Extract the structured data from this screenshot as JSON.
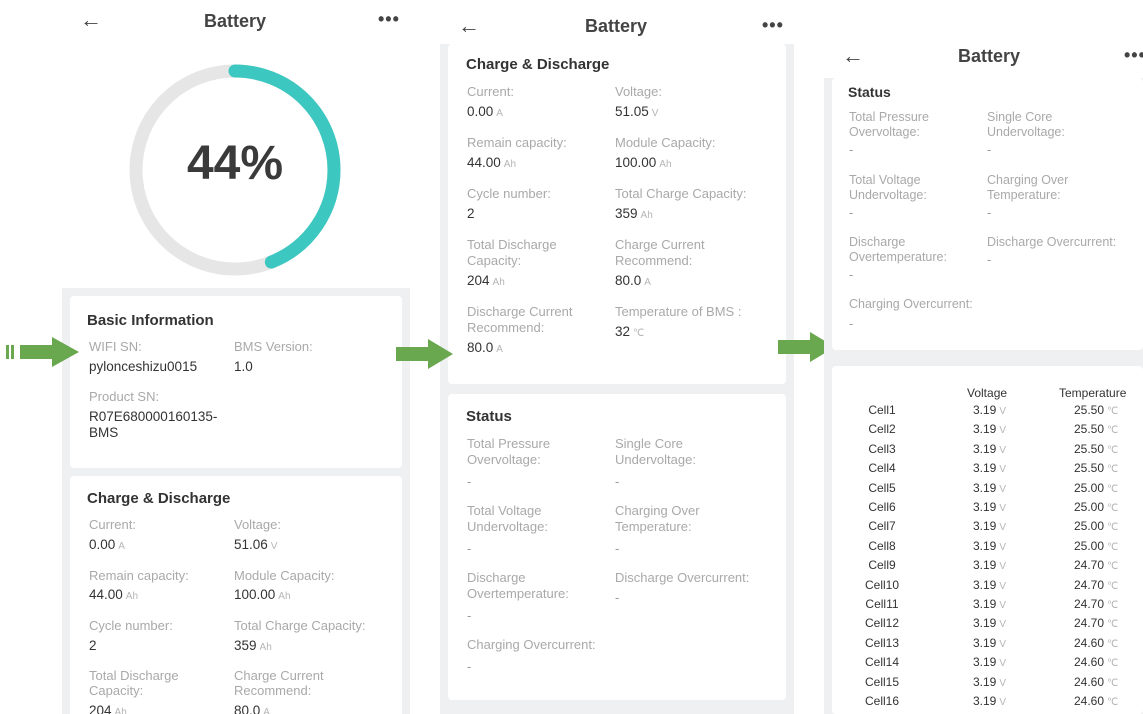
{
  "screens": [
    {
      "title": "Battery",
      "back_icon": "arrow-left-icon",
      "more_icon": "more-icon"
    },
    {
      "title": "Battery",
      "back_icon": "arrow-left-icon",
      "more_icon": "more-icon"
    },
    {
      "title": "Battery",
      "back_icon": "arrow-left-icon",
      "more_icon": "more-icon"
    }
  ],
  "gauge": {
    "percent_label": "44%",
    "value": 0.44,
    "track_color": "#e6e6e6",
    "fill_color": "#3cc8c0"
  },
  "basic_info": {
    "title": "Basic Information",
    "wifi_sn_label": "WIFI SN:",
    "wifi_sn_value": "pylonceshizu0015",
    "bms_version_label": "BMS Version:",
    "bms_version_value": "1.0",
    "product_sn_label": "Product SN:",
    "product_sn_value_line1": "R07E680000160135-",
    "product_sn_value_line2": "BMS"
  },
  "charge1": {
    "title": "Charge & Discharge",
    "current_label": "Current:",
    "current_value": "0.00",
    "current_unit": "A",
    "voltage_label": "Voltage:",
    "voltage_value": "51.06",
    "voltage_unit": "V",
    "remain_label": "Remain capacity:",
    "remain_value": "44.00",
    "remain_unit": "Ah",
    "module_label": "Module Capacity:",
    "module_value": "100.00",
    "module_unit": "Ah",
    "cycle_label": "Cycle number:",
    "cycle_value": "2",
    "total_charge_label": "Total Charge Capacity:",
    "total_charge_value": "359",
    "total_charge_unit": "Ah",
    "total_discharge_label1": "Total Discharge",
    "total_discharge_label2": "Capacity:",
    "total_discharge_value": "204",
    "total_discharge_unit": "Ah",
    "charge_rec_label1": "Charge Current",
    "charge_rec_label2": "Recommend:",
    "charge_rec_value": "80.0",
    "charge_rec_unit": "A"
  },
  "charge2": {
    "title": "Charge & Discharge",
    "current_label": "Current:",
    "current_value": "0.00",
    "current_unit": "A",
    "voltage_label": "Voltage:",
    "voltage_value": "51.05",
    "voltage_unit": "V",
    "remain_label": "Remain capacity:",
    "remain_value": "44.00",
    "remain_unit": "Ah",
    "module_label": "Module Capacity:",
    "module_value": "100.00",
    "module_unit": "Ah",
    "cycle_label": "Cycle number:",
    "cycle_value": "2",
    "total_charge_label": "Total Charge Capacity:",
    "total_charge_value": "359",
    "total_charge_unit": "Ah",
    "total_discharge_label1": "Total Discharge",
    "total_discharge_label2": "Capacity:",
    "total_discharge_value": "204",
    "total_discharge_unit": "Ah",
    "charge_rec_label1": "Charge Current",
    "charge_rec_label2": "Recommend:",
    "charge_rec_value": "80.0",
    "charge_rec_unit": "A",
    "discharge_rec_label1": "Discharge Current",
    "discharge_rec_label2": "Recommend:",
    "discharge_rec_value": "80.0",
    "discharge_rec_unit": "A",
    "bms_temp_label": "Temperature of BMS :",
    "bms_temp_value": "32",
    "bms_temp_unit": "℃"
  },
  "status": {
    "title": "Status",
    "tp_over_label1": "Total Pressure",
    "tp_over_label2": "Overvoltage:",
    "tp_over_value": "-",
    "sc_under_label1": "Single Core",
    "sc_under_label2": "Undervoltage:",
    "sc_under_value": "-",
    "tv_under_label1": "Total Voltage",
    "tv_under_label2": "Undervoltage:",
    "tv_under_value": "-",
    "co_temp_label1": "Charging Over",
    "co_temp_label2": "Temperature:",
    "co_temp_value": "-",
    "dis_ot_label1": "Discharge",
    "dis_ot_label2": "Overtemperature:",
    "dis_ot_value": "-",
    "dis_oc_label": "Discharge Overcurrent:",
    "dis_oc_value": "-",
    "ch_oc_label": "Charging Overcurrent:",
    "ch_oc_value": "-"
  },
  "cells": {
    "voltage_header": "Voltage",
    "temperature_header": "Temperature",
    "voltage_unit": "V",
    "temp_unit": "℃",
    "rows": [
      {
        "name": "Cell1",
        "v": "3.19",
        "t": "25.50"
      },
      {
        "name": "Cell2",
        "v": "3.19",
        "t": "25.50"
      },
      {
        "name": "Cell3",
        "v": "3.19",
        "t": "25.50"
      },
      {
        "name": "Cell4",
        "v": "3.19",
        "t": "25.50"
      },
      {
        "name": "Cell5",
        "v": "3.19",
        "t": "25.00"
      },
      {
        "name": "Cell6",
        "v": "3.19",
        "t": "25.00"
      },
      {
        "name": "Cell7",
        "v": "3.19",
        "t": "25.00"
      },
      {
        "name": "Cell8",
        "v": "3.19",
        "t": "25.00"
      },
      {
        "name": "Cell9",
        "v": "3.19",
        "t": "24.70"
      },
      {
        "name": "Cell10",
        "v": "3.19",
        "t": "24.70"
      },
      {
        "name": "Cell11",
        "v": "3.19",
        "t": "24.70"
      },
      {
        "name": "Cell12",
        "v": "3.19",
        "t": "24.70"
      },
      {
        "name": "Cell13",
        "v": "3.19",
        "t": "24.60"
      },
      {
        "name": "Cell14",
        "v": "3.19",
        "t": "24.60"
      },
      {
        "name": "Cell15",
        "v": "3.19",
        "t": "24.60"
      },
      {
        "name": "Cell16",
        "v": "3.19",
        "t": "24.60"
      }
    ]
  },
  "arrows": {
    "color": "#6aa84f",
    "icon": "arrow-right-icon"
  }
}
